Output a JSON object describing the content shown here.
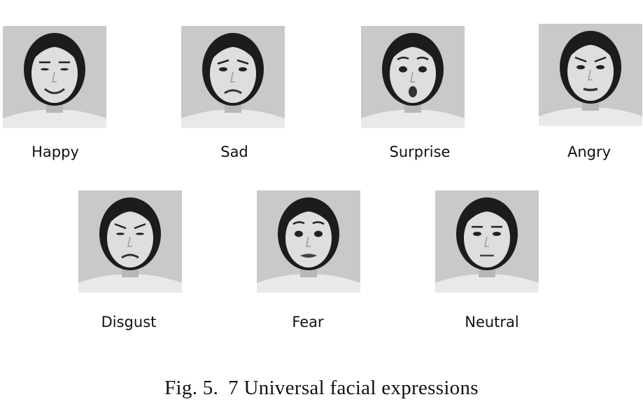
{
  "figure": {
    "row1": [
      {
        "label": "Happy"
      },
      {
        "label": "Sad"
      },
      {
        "label": "Surprise"
      },
      {
        "label": "Angry"
      }
    ],
    "row2": [
      {
        "label": "Disgust"
      },
      {
        "label": "Fear"
      },
      {
        "label": "Neutral"
      }
    ],
    "caption": {
      "number": "Fig. 5.",
      "text": "7 Universal facial expressions"
    }
  }
}
